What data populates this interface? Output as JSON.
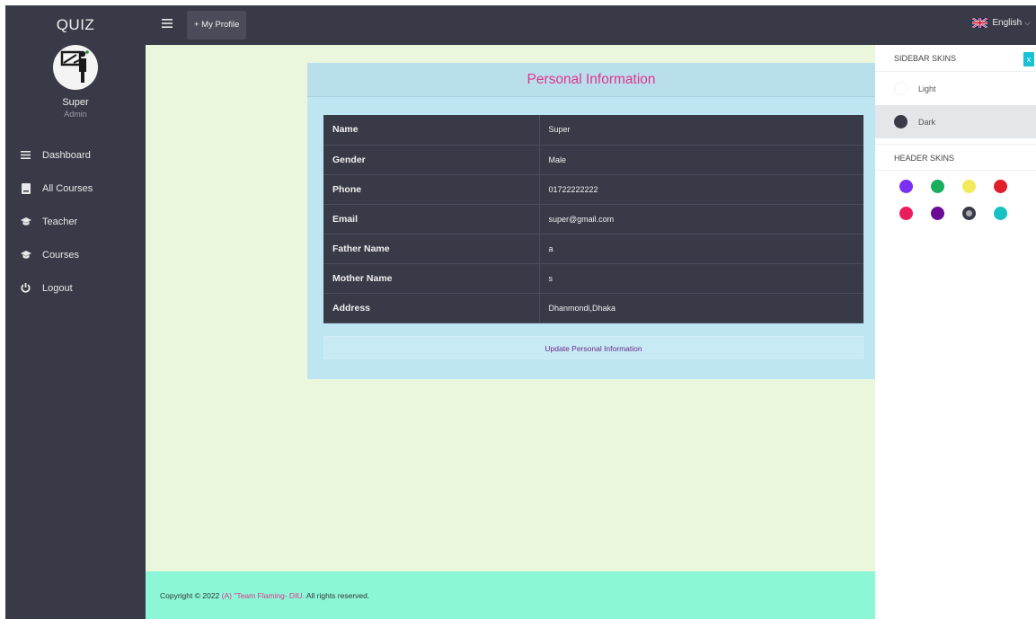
{
  "sidebar": {
    "brand": "QUIZ",
    "user": {
      "name": "Super",
      "role": "Admin"
    },
    "items": [
      {
        "label": "Dashboard",
        "icon": "hamburger-icon"
      },
      {
        "label": "All Courses",
        "icon": "book-icon"
      },
      {
        "label": "Teacher",
        "icon": "graduation-cap-icon"
      },
      {
        "label": "Courses",
        "icon": "graduation-cap-icon"
      },
      {
        "label": "Logout",
        "icon": "power-icon"
      }
    ]
  },
  "header": {
    "profile_button": "+ My Profile",
    "language": "English"
  },
  "card": {
    "title": "Personal Information",
    "rows": [
      {
        "label": "Name",
        "value": "Super"
      },
      {
        "label": "Gender",
        "value": "Male"
      },
      {
        "label": "Phone",
        "value": "01722222222"
      },
      {
        "label": "Email",
        "value": "super@gmail.com"
      },
      {
        "label": "Father Name",
        "value": "a"
      },
      {
        "label": "Mother Name",
        "value": "s"
      },
      {
        "label": "Address",
        "value": "Dhanmondi,Dhaka"
      }
    ],
    "update_button": "Update Personal Information"
  },
  "footer": {
    "prefix": "Copyright © 2022",
    "brand": "(A) \"Team Flaming- DIU.",
    "suffix": "All rights reserved."
  },
  "skins": {
    "close_label": "x",
    "sidebar_title": "SIDEBAR SKINS",
    "sidebar_options": [
      {
        "label": "Light"
      },
      {
        "label": "Dark"
      }
    ],
    "header_title": "HEADER SKINS",
    "header_colors": [
      "#7b2ff2",
      "#1aae5c",
      "#f2e95b",
      "#e01f2a",
      "#ea1d5d",
      "#6b0a94",
      "#383a48",
      "#16c2c3"
    ]
  }
}
